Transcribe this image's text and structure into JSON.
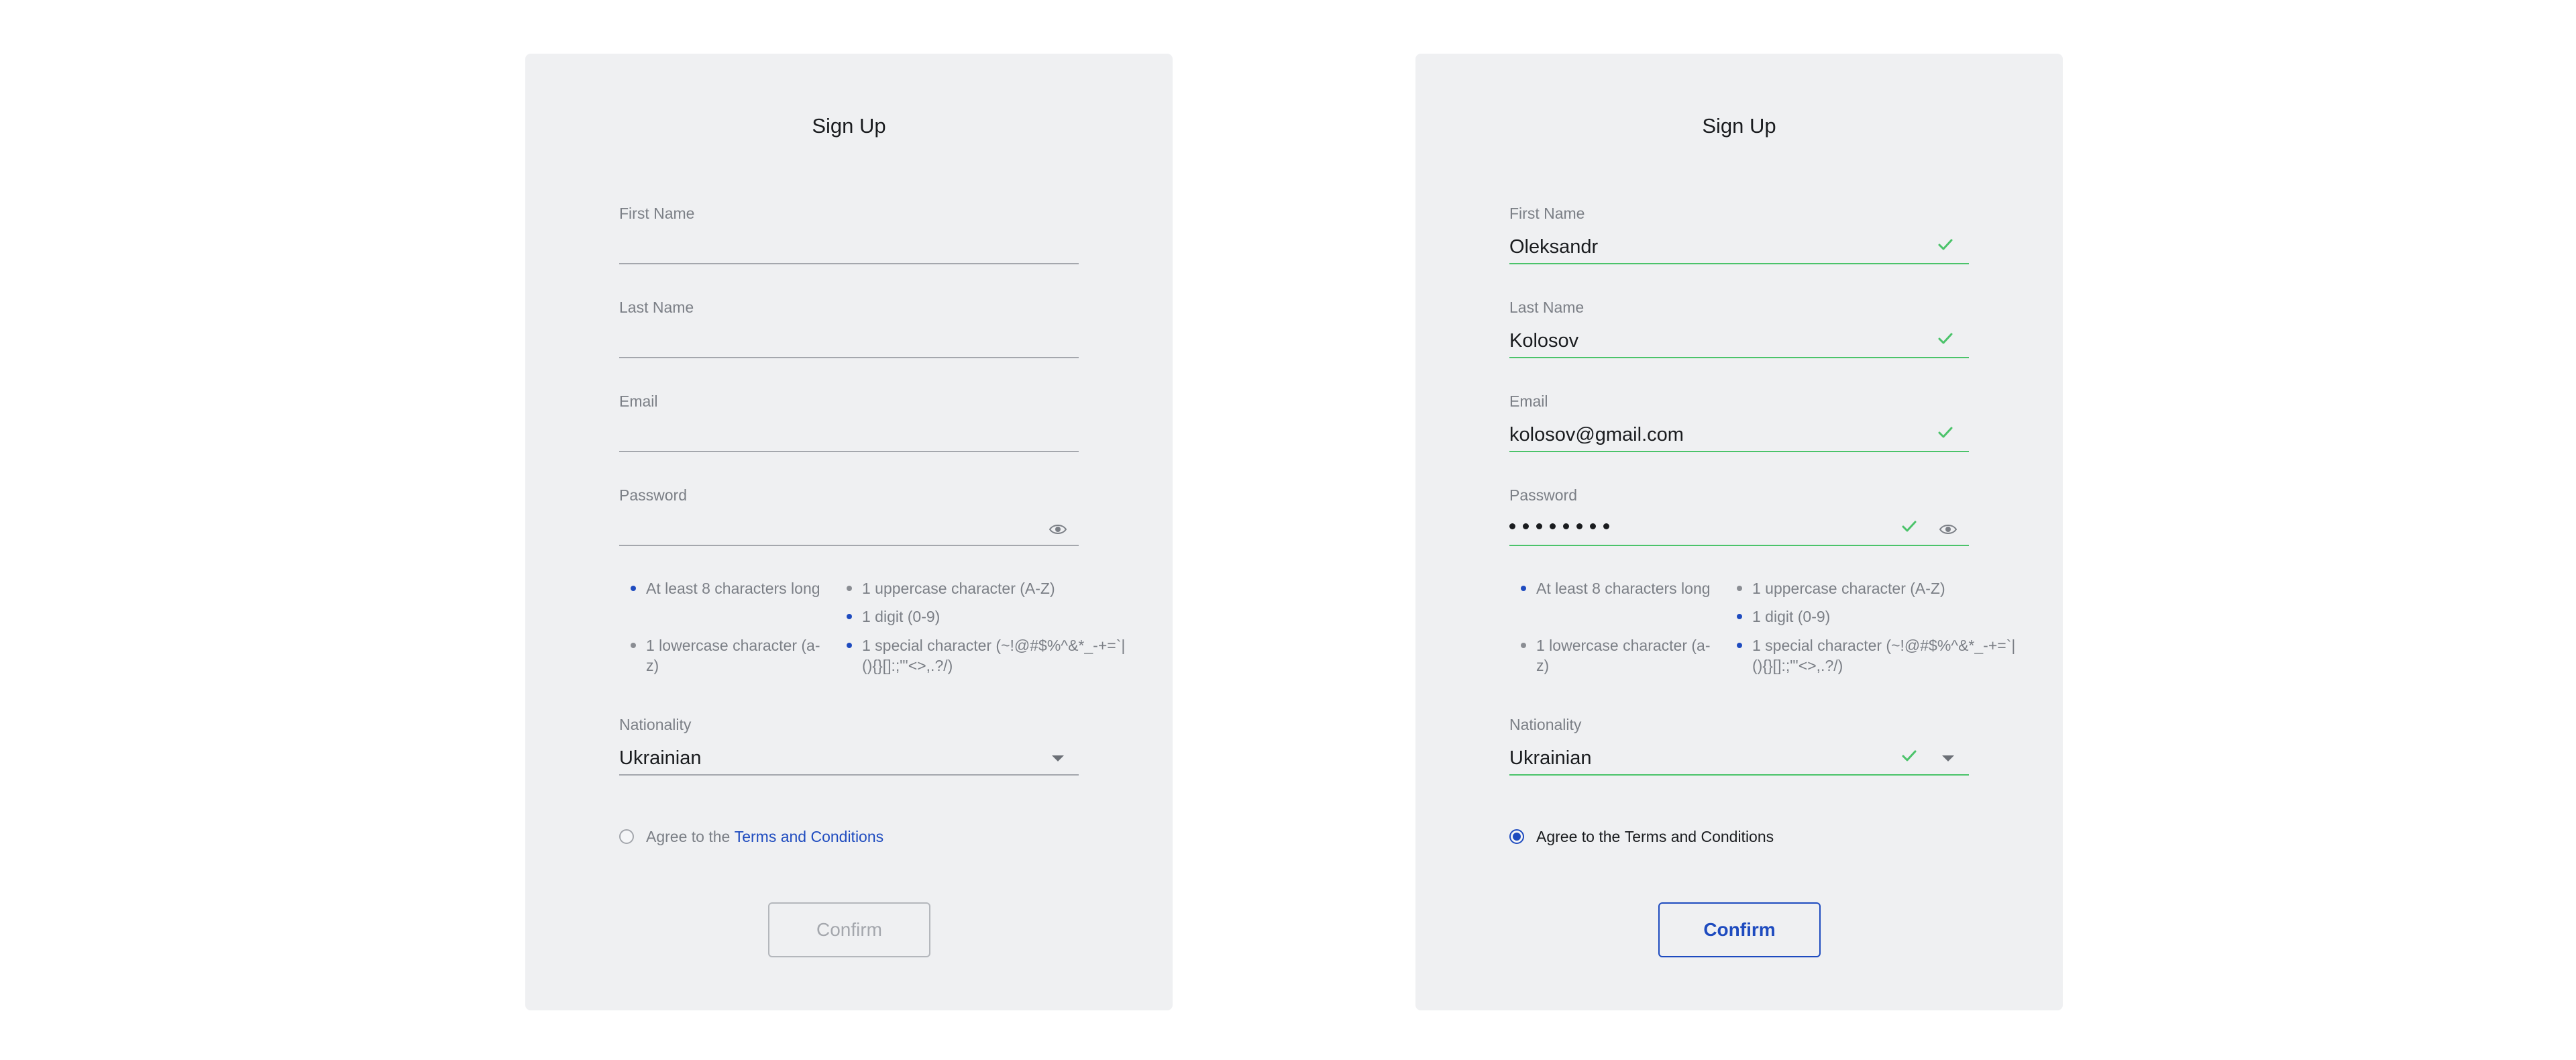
{
  "forms": [
    {
      "title": "Sign Up",
      "first_name": {
        "label": "First Name",
        "value": ""
      },
      "last_name": {
        "label": "Last Name",
        "value": ""
      },
      "email": {
        "label": "Email",
        "value": ""
      },
      "password": {
        "label": "Password",
        "masked_length": 0
      },
      "requirements": [
        {
          "text": "At least 8 characters long",
          "met": true
        },
        {
          "text": "1 lowercase character (a-z)",
          "met": false
        },
        {
          "text": "1 uppercase character (A-Z)",
          "met": false
        },
        {
          "text": "1 digit (0-9)",
          "met": true
        },
        {
          "text": "1 special character (~!@#$%^&*_-+=`|(){}[]:;\"'<>,.?/)",
          "met": true
        }
      ],
      "nationality": {
        "label": "Nationality",
        "value": "Ukrainian"
      },
      "agree": {
        "prefix": "Agree to the ",
        "link": "Terms and Conditions",
        "checked": false
      },
      "confirm_label": "Confirm",
      "confirm_enabled": false
    },
    {
      "title": "Sign Up",
      "first_name": {
        "label": "First Name",
        "value": "Oleksandr"
      },
      "last_name": {
        "label": "Last Name",
        "value": "Kolosov"
      },
      "email": {
        "label": "Email",
        "value": "kolosov@gmail.com"
      },
      "password": {
        "label": "Password",
        "masked_length": 8
      },
      "requirements": [
        {
          "text": "At least 8 characters long",
          "met": true
        },
        {
          "text": "1 lowercase character (a-z)",
          "met": false
        },
        {
          "text": "1 uppercase character (A-Z)",
          "met": false
        },
        {
          "text": "1 digit (0-9)",
          "met": true
        },
        {
          "text": "1 special character (~!@#$%^&*_-+=`|(){}[]:;\"'<>,.?/)",
          "met": true
        }
      ],
      "nationality": {
        "label": "Nationality",
        "value": "Ukrainian"
      },
      "agree": {
        "prefix": "Agree to the ",
        "link": "Terms and Conditions",
        "checked": true
      },
      "confirm_label": "Confirm",
      "confirm_enabled": true
    }
  ],
  "colors": {
    "card_bg": "#eff0f2",
    "valid_green": "#4bc36a",
    "accent_blue": "#1e4bbf",
    "muted_text": "#7b7f86"
  },
  "icons": {
    "valid": "check-icon",
    "toggle_password": "eye-icon",
    "dropdown": "caret-down-icon"
  }
}
